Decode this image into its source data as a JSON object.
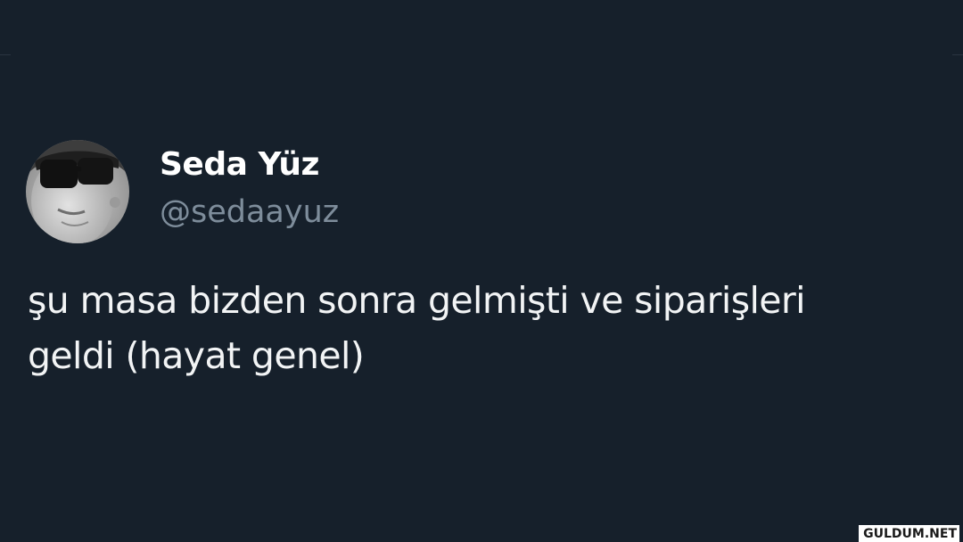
{
  "tweet": {
    "display_name": "Seda Yüz",
    "handle": "@sedaayuz",
    "text": "şu masa bizden sonra gelmişti ve siparişleri\ngeldi (hayat genel)"
  },
  "watermark": {
    "text": "GULDUM.NET"
  },
  "colors": {
    "background": "#16202b",
    "display_name": "#ffffff",
    "handle": "#7e8d9b",
    "text": "#f2f4f5"
  }
}
